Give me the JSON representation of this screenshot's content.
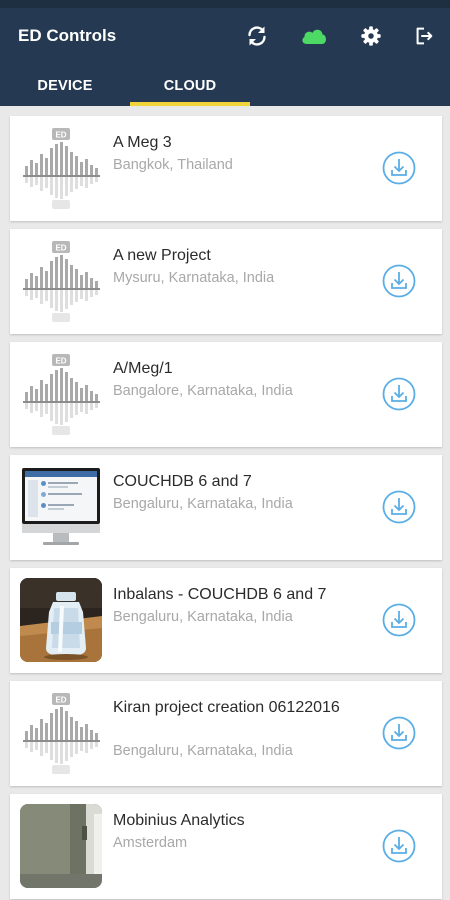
{
  "app": {
    "title": "ED Controls",
    "actions": [
      {
        "icon": "sync-icon"
      },
      {
        "icon": "cloud-icon",
        "color": "#4cd964"
      },
      {
        "icon": "gear-icon"
      },
      {
        "icon": "logout-icon"
      }
    ]
  },
  "tabs": [
    {
      "label": "DEVICE",
      "active": false
    },
    {
      "label": "CLOUD",
      "active": true
    }
  ],
  "colors": {
    "header": "#253a52",
    "tab_indicator": "#f1d43a",
    "download_icon": "#5aaee6",
    "cloud_icon": "#4cd964"
  },
  "projects": [
    {
      "title": "A Meg 3",
      "location": "Bangkok, Thailand",
      "thumb": "placeholder-logo"
    },
    {
      "title": "A new Project",
      "location": "Mysuru, Karnataka, India",
      "thumb": "placeholder-logo"
    },
    {
      "title": "A/Meg/1",
      "location": "Bangalore, Karnataka, India",
      "thumb": "placeholder-logo"
    },
    {
      "title": "COUCHDB 6 and 7",
      "location": "Bengaluru, Karnataka, India",
      "thumb": "monitor-photo"
    },
    {
      "title": "Inbalans - COUCHDB 6 and 7",
      "location": "Bengaluru, Karnataka, India",
      "thumb": "bottle-photo"
    },
    {
      "title": "Kiran project creation 06122016",
      "location": "Bengaluru, Karnataka, India",
      "thumb": "placeholder-logo"
    },
    {
      "title": "Mobinius Analytics",
      "location": "Amsterdam",
      "thumb": "wall-photo"
    }
  ]
}
